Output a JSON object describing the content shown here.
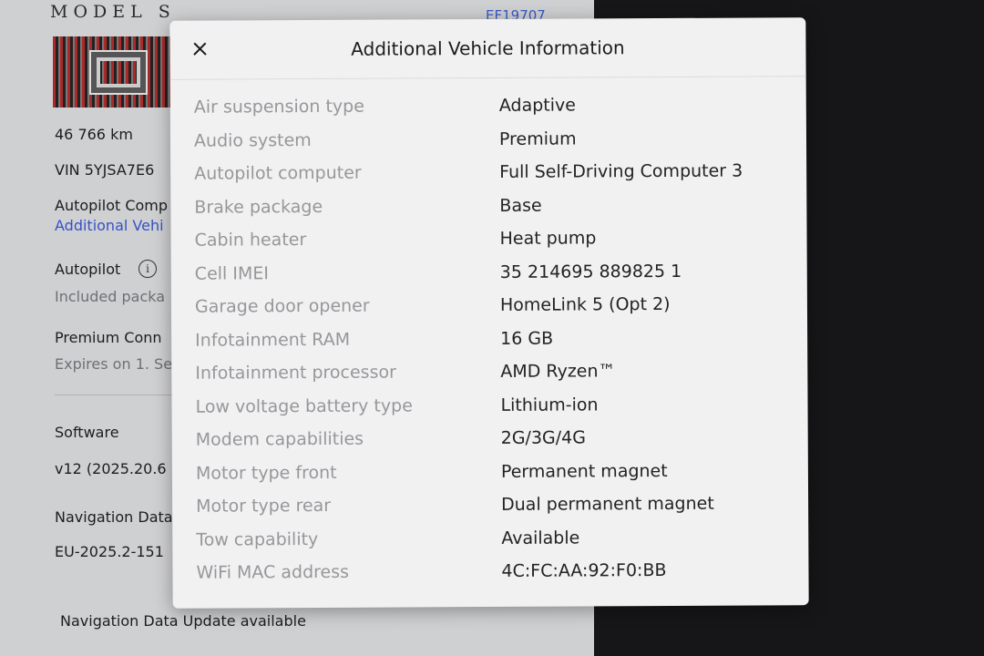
{
  "background": {
    "model_logo": "MODEL S",
    "car_name": "EF19707",
    "odometer": "46 766  km",
    "vin": "VIN 5YJSA7E6",
    "autopilot_computer_label": "Autopilot Comp",
    "additional_info_link": "Additional Vehi",
    "autopilot_label": "Autopilot",
    "autopilot_sub": "Included packa",
    "premium_conn_label": "Premium Conn",
    "premium_conn_sub": "Expires on 1. Se",
    "software_label": "Software",
    "software_version": "v12 (2025.20.6",
    "nav_data_label": "Navigation Data",
    "nav_data_version": "EU-2025.2-151",
    "nav_update": "Navigation Data Update available"
  },
  "modal": {
    "title": "Additional Vehicle Information",
    "specs": [
      {
        "label": "Air suspension type",
        "value": "Adaptive"
      },
      {
        "label": "Audio system",
        "value": "Premium"
      },
      {
        "label": "Autopilot computer",
        "value": "Full Self-Driving Computer 3"
      },
      {
        "label": "Brake package",
        "value": "Base"
      },
      {
        "label": "Cabin heater",
        "value": "Heat pump"
      },
      {
        "label": "Cell IMEI",
        "value": "35 214695 889825 1"
      },
      {
        "label": "Garage door opener",
        "value": "HomeLink 5 (Opt 2)"
      },
      {
        "label": "Infotainment RAM",
        "value": "16 GB"
      },
      {
        "label": "Infotainment processor",
        "value": "AMD Ryzen™"
      },
      {
        "label": "Low voltage battery type",
        "value": "Lithium-ion"
      },
      {
        "label": "Modem capabilities",
        "value": "2G/3G/4G"
      },
      {
        "label": "Motor type front",
        "value": "Permanent magnet"
      },
      {
        "label": "Motor type rear",
        "value": "Dual permanent magnet"
      },
      {
        "label": "Tow capability",
        "value": "Available"
      },
      {
        "label": "WiFi MAC address",
        "value": "4C:FC:AA:92:F0:BB"
      }
    ]
  },
  "colors": {
    "modal_bg": "#f1f1f2",
    "label": "#96979a",
    "value": "#232325",
    "link": "#3553c4"
  },
  "icons": {
    "close": "close-icon",
    "info": "info-icon"
  }
}
